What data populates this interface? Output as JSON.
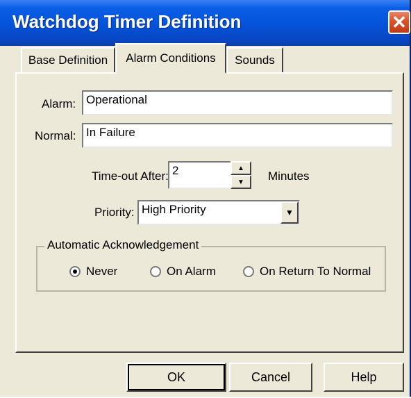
{
  "window": {
    "title": "Watchdog Timer Definition",
    "close_icon": "✕"
  },
  "tabs": [
    {
      "label": "Base Definition",
      "active": false
    },
    {
      "label": "Alarm Conditions",
      "active": true
    },
    {
      "label": "Sounds",
      "active": false
    }
  ],
  "form": {
    "alarm_label": "Alarm:",
    "alarm_value": "Operational",
    "normal_label": "Normal:",
    "normal_value": "In Failure",
    "timeout_label": "Time-out After:",
    "timeout_value": "2",
    "timeout_unit": "Minutes",
    "priority_label": "Priority:",
    "priority_value": "High Priority"
  },
  "auto_ack": {
    "legend": "Automatic Acknowledgement",
    "options": [
      {
        "label": "Never",
        "checked": true
      },
      {
        "label": "On Alarm",
        "checked": false
      },
      {
        "label": "On Return To Normal",
        "checked": false
      }
    ]
  },
  "buttons": {
    "ok": "OK",
    "cancel": "Cancel",
    "help": "Help"
  },
  "colors": {
    "title_bar": "#0552d9",
    "close_button": "#d9532b",
    "dialog_background": "#ece9d8"
  }
}
